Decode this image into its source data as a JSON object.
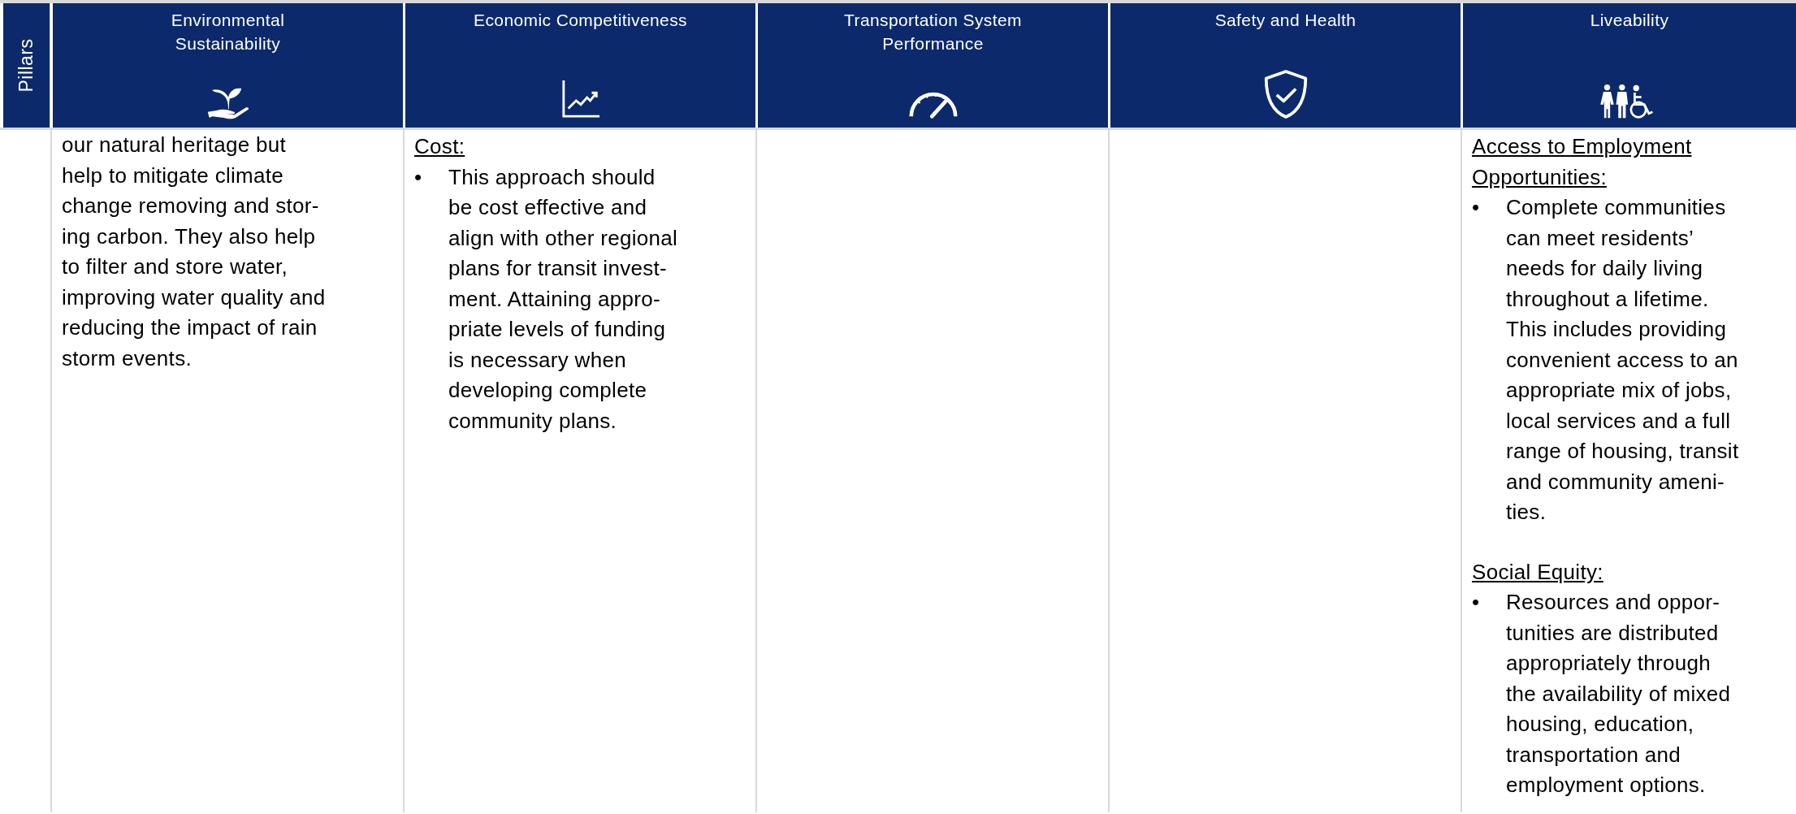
{
  "row_label": "Pillars",
  "pillars": [
    {
      "title": "Environmental Sustainability",
      "sections": [
        {
          "kind": "paragraph",
          "text": "our natural heritage but\nhelp to mitigate climate\nchange removing and stor-\ning carbon. They also help\nto filter and store water,\nimproving water quality and\nreducing the impact of rain\nstorm events."
        }
      ]
    },
    {
      "title": "Economic Competitiveness",
      "sections": [
        {
          "kind": "topic",
          "heading": "Cost:",
          "items": [
            {
              "marker": "•",
              "text": "This approach should\nbe cost effective and\nalign with other regional\nplans for transit invest-\nment. Attaining appro-\npriate levels of funding\nis necessary when\ndeveloping complete\ncommunity plans."
            }
          ]
        }
      ]
    },
    {
      "title": "Transportation System Performance"
    },
    {
      "title": "Safety and Health"
    },
    {
      "title": "Liveability",
      "sections": [
        {
          "kind": "topic",
          "heading": "Access to Employment\nOpportunities:",
          "items": [
            {
              "marker": "•",
              "text": "Complete communities\ncan meet residents’\nneeds for daily living\nthroughout a lifetime.\nThis includes providing\nconvenient access to an\nappropriate mix of jobs,\nlocal services and a full\nrange of housing, transit\nand community ameni-\nties."
            }
          ]
        },
        {
          "kind": "topic",
          "heading": "Social Equity:",
          "items": [
            {
              "marker": "•",
              "text": "Resources and oppor-\ntunities are distributed\nappropriately through\nthe availability of mixed\nhousing, education,\ntransportation and\nemployment options."
            }
          ]
        }
      ]
    }
  ]
}
